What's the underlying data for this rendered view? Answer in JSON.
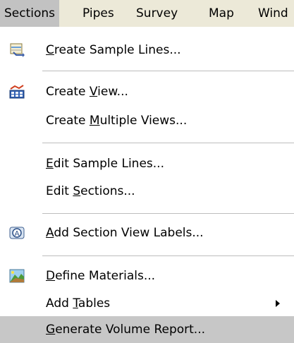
{
  "menubar": {
    "items": [
      "Sections",
      "Pipes",
      "Survey",
      "Map",
      "Wind"
    ]
  },
  "menu": {
    "items": [
      {
        "pre": "",
        "u": "C",
        "post": "reate Sample Lines...",
        "icon": "sample-lines-icon"
      },
      {
        "pre": "Create ",
        "u": "V",
        "post": "iew...",
        "icon": "section-view-icon"
      },
      {
        "pre": "Create ",
        "u": "M",
        "post": "ultiple Views...",
        "icon": ""
      },
      {
        "pre": "",
        "u": "E",
        "post": "dit Sample Lines...",
        "icon": ""
      },
      {
        "pre": "Edit ",
        "u": "S",
        "post": "ections...",
        "icon": ""
      },
      {
        "pre": "",
        "u": "A",
        "post": "dd Section View Labels...",
        "icon": "label-icon"
      },
      {
        "pre": "",
        "u": "D",
        "post": "efine Materials...",
        "icon": "materials-icon"
      },
      {
        "pre": "Add ",
        "u": "T",
        "post": "ables",
        "icon": "",
        "submenu": true
      },
      {
        "pre": "",
        "u": "G",
        "post": "enerate Volume Report...",
        "icon": "",
        "highlighted": true
      }
    ]
  }
}
